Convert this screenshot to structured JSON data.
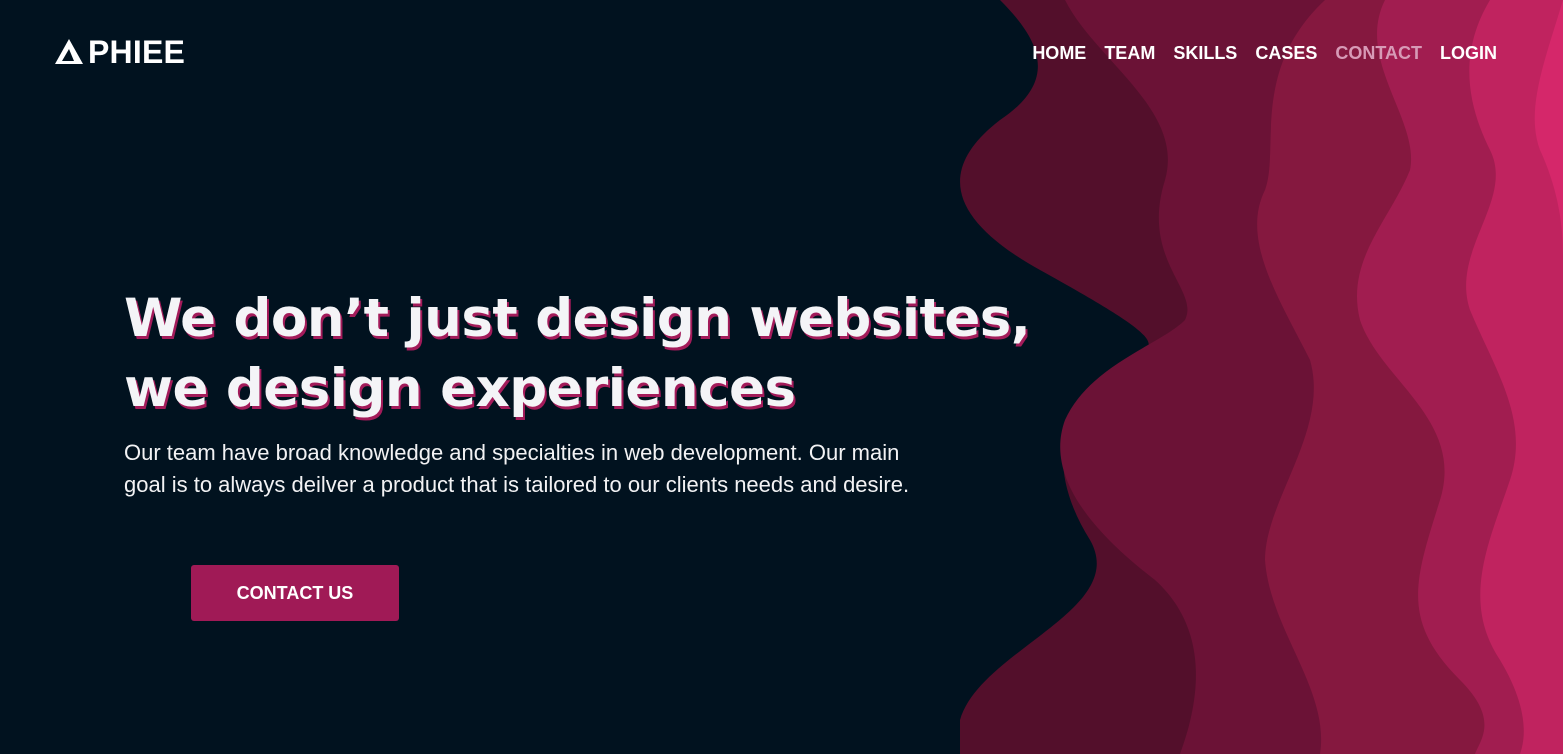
{
  "brand": {
    "name": "PHIEE",
    "icon": "triangle-logo-icon"
  },
  "nav": {
    "items": [
      {
        "label": "HOME"
      },
      {
        "label": "TEAM"
      },
      {
        "label": "SKILLS"
      },
      {
        "label": "CASES"
      },
      {
        "label": "CONTACT",
        "active": true
      },
      {
        "label": "LOGIN"
      }
    ]
  },
  "hero": {
    "headline_line1": "We don’t just design websites,",
    "headline_line2": "we design experiences",
    "description": "Our team have broad knowledge and specialties in web development. Our main goal is to always deilver a product that is tailored to our clients needs and desire.",
    "cta_label": "CONTACT US"
  },
  "colors": {
    "background": "#01121f",
    "accent": "#a01a56",
    "nav_active": "#d79ab6",
    "wave_1": "#530f2b",
    "wave_2": "#6b1236",
    "wave_3": "#85183f",
    "wave_4": "#a11d50",
    "wave_5": "#c0235f"
  }
}
